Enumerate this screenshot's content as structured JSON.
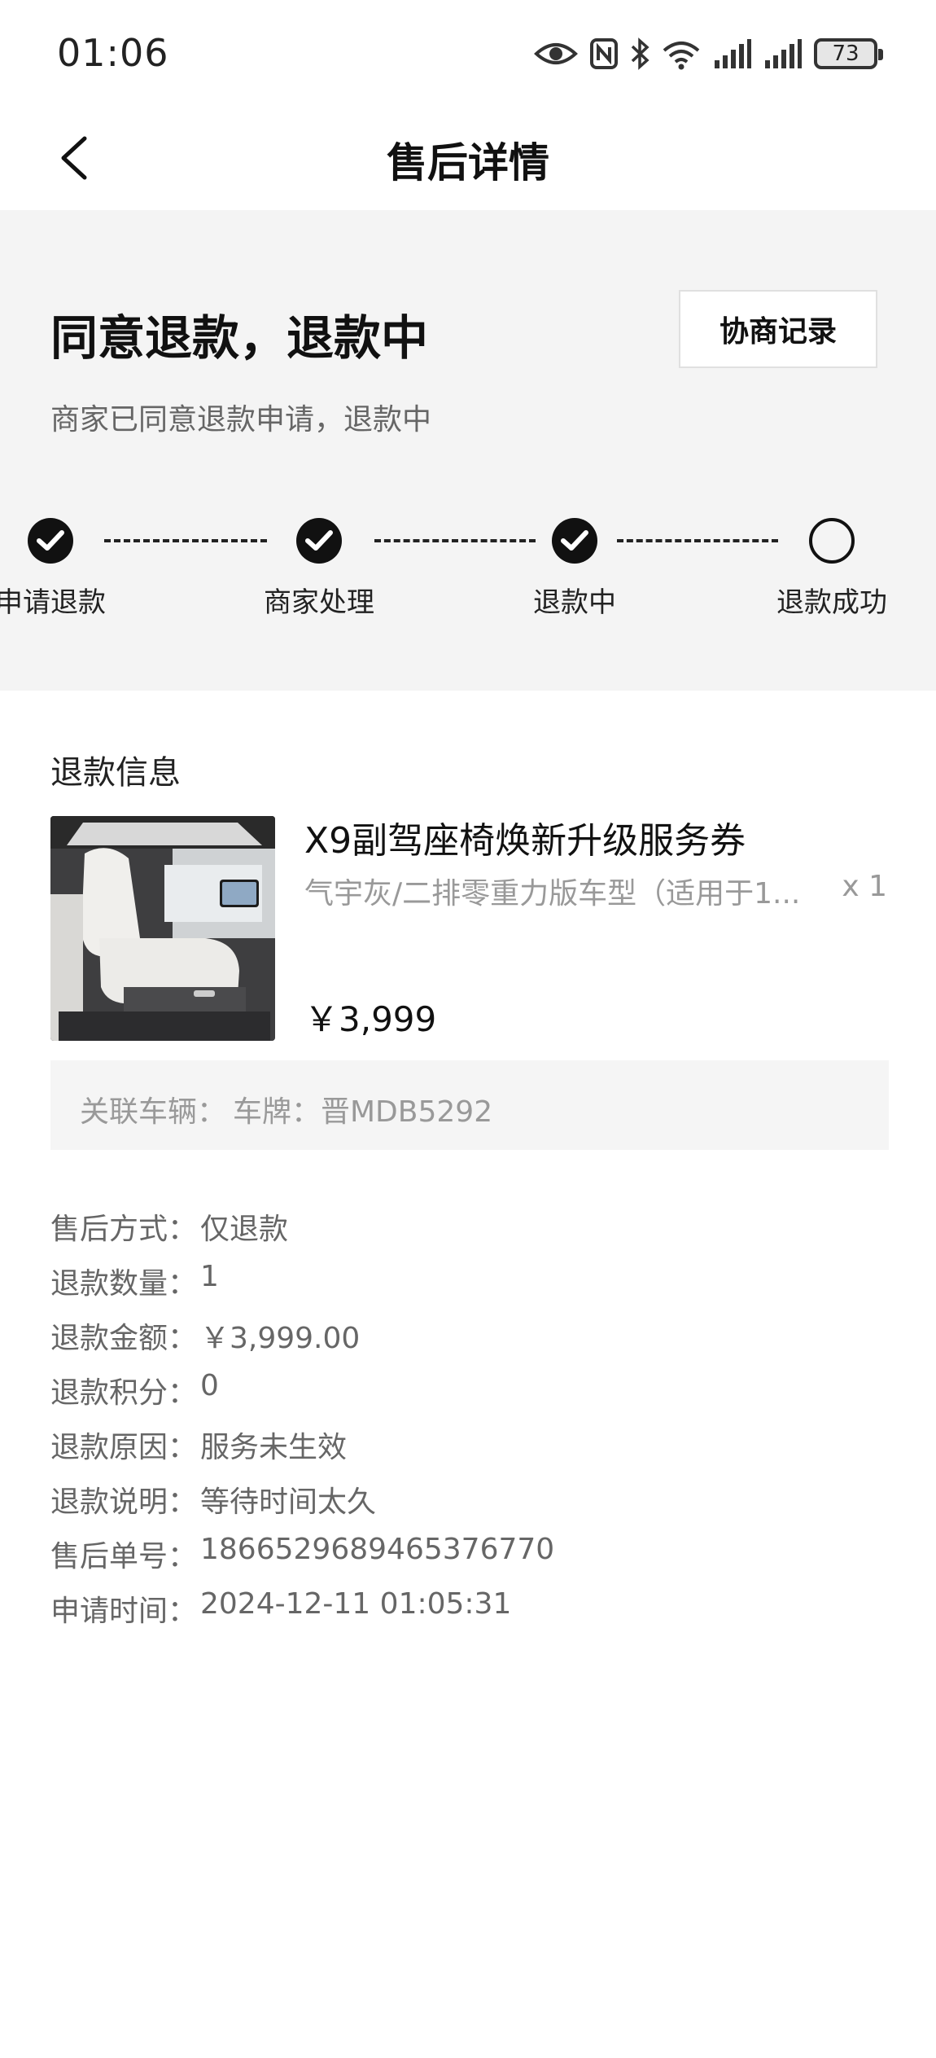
{
  "status_bar": {
    "time": "01:06",
    "battery": "73",
    "icons": [
      "eye-icon",
      "nfc-icon",
      "bluetooth-icon",
      "wifi-icon",
      "signal-icon",
      "signal-icon",
      "battery-icon"
    ]
  },
  "nav": {
    "title": "售后详情",
    "back_icon": "chevron-left-icon"
  },
  "status": {
    "title": "同意退款，退款中",
    "subtitle": "商家已同意退款申请，退款中",
    "negotiation_button": "协商记录"
  },
  "steps": [
    {
      "label": "申请退款",
      "done": true
    },
    {
      "label": "商家处理",
      "done": true
    },
    {
      "label": "退款中",
      "done": true
    },
    {
      "label": "退款成功",
      "done": false
    }
  ],
  "refund_info": {
    "section_title": "退款信息",
    "product": {
      "name": "X9副驾座椅焕新升级服务券",
      "spec": "气宇灰/二排零重力版车型（适用于1...",
      "quantity": "x 1",
      "price": "￥3,999"
    },
    "vehicle": {
      "label": "关联车辆：",
      "value": "车牌：晋MDB5292"
    },
    "details": [
      {
        "key": "售后方式：",
        "value": "仅退款"
      },
      {
        "key": "退款数量：",
        "value": "1"
      },
      {
        "key": "退款金额：",
        "value": "￥3,999.00"
      },
      {
        "key": "退款积分：",
        "value": "0"
      },
      {
        "key": "退款原因：",
        "value": "服务未生效"
      },
      {
        "key": "退款说明：",
        "value": "等待时间太久"
      },
      {
        "key": "售后单号：",
        "value": "1866529689465376770"
      },
      {
        "key": "申请时间：",
        "value": "2024-12-11 01:05:31"
      }
    ]
  }
}
